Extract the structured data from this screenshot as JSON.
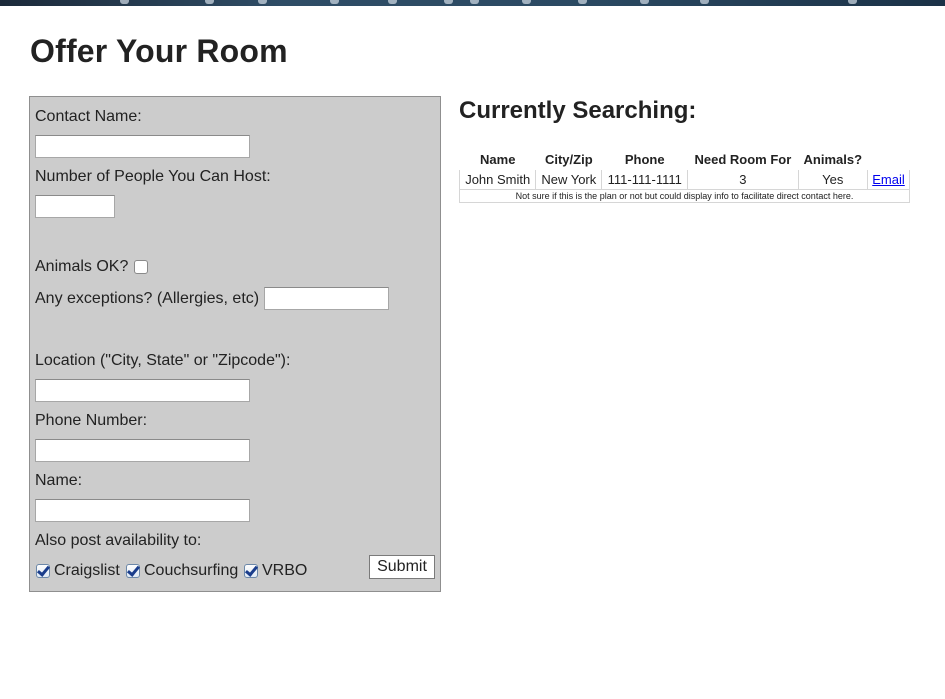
{
  "page": {
    "title": "Offer Your Room"
  },
  "form": {
    "contact_name_label": "Contact Name:",
    "contact_name_value": "",
    "people_label": "Number of People You Can Host:",
    "people_value": "",
    "animals_label": "Animals OK?",
    "animals_checked": false,
    "exceptions_label": "Any exceptions? (Allergies, etc)",
    "exceptions_value": "",
    "location_label": "Location (\"City, State\" or \"Zipcode\"):",
    "location_value": "",
    "phone_label": "Phone Number:",
    "phone_value": "",
    "name_label": "Name:",
    "name_value": "",
    "post_label": "Also post availability to:",
    "post_options": [
      {
        "label": "Craigslist",
        "checked": true
      },
      {
        "label": "Couchsurfing",
        "checked": true
      },
      {
        "label": "VRBO",
        "checked": true
      }
    ],
    "submit_label": "Submit"
  },
  "searching": {
    "title": "Currently Searching:",
    "columns": [
      "Name",
      "City/Zip",
      "Phone",
      "Need Room For",
      "Animals?"
    ],
    "rows": [
      {
        "name": "John Smith",
        "city": "New York",
        "phone": "111-111-1111",
        "need_room_for": "3",
        "animals": "Yes",
        "contact_link": "Email"
      }
    ],
    "note": "Not sure if this is the plan or not but could display info to facilitate direct contact here."
  }
}
